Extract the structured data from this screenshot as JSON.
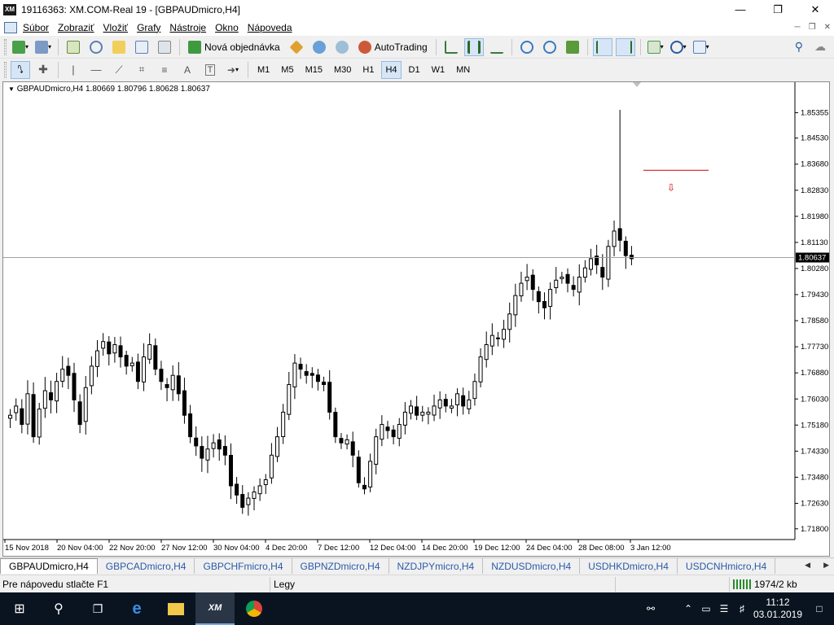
{
  "window": {
    "title": "19116363: XM.COM-Real 19 - [GBPAUDmicro,H4]",
    "logo": "XM"
  },
  "menu": [
    "Súbor",
    "Zobraziť",
    "Vložiť",
    "Grafy",
    "Nástroje",
    "Okno",
    "Nápoveda"
  ],
  "toolbar1": {
    "new_order_label": "Nová objednávka",
    "autotrading_label": "AutoTrading"
  },
  "timeframes": [
    "M1",
    "M5",
    "M15",
    "M30",
    "H1",
    "H4",
    "D1",
    "W1",
    "MN"
  ],
  "active_timeframe": "H4",
  "chart_header": "GBPAUDmicro,H4  1.80669 1.80796 1.80628 1.80637",
  "chart_data": {
    "type": "candlestick",
    "symbol": "GBPAUDmicro",
    "timeframe": "H4",
    "ohlc_header": {
      "open": 1.80669,
      "high": 1.80796,
      "low": 1.80628,
      "close": 1.80637
    },
    "current_price": 1.80637,
    "current_price_label": "1.80637",
    "ylim": [
      1.7145,
      1.8635
    ],
    "y_ticks": [
      1.85355,
      1.8453,
      1.8368,
      1.8283,
      1.8198,
      1.8113,
      1.8028,
      1.7943,
      1.7858,
      1.7773,
      1.7688,
      1.7603,
      1.7518,
      1.7433,
      1.7348,
      1.7263,
      1.718
    ],
    "y_tick_labels": [
      "1.85355",
      "1.84530",
      "1.83680",
      "1.82830",
      "1.81980",
      "1.81130",
      "1.80280",
      "1.79430",
      "1.78580",
      "1.77730",
      "1.76880",
      "1.76030",
      "1.75180",
      "1.74330",
      "1.73480",
      "1.72630",
      "1.71800"
    ],
    "x_tick_labels": [
      "15 Nov 2018",
      "20 Nov 04:00",
      "22 Nov 20:00",
      "27 Nov 12:00",
      "30 Nov 04:00",
      "4 Dec 20:00",
      "7 Dec 12:00",
      "12 Dec 04:00",
      "14 Dec 20:00",
      "19 Dec 12:00",
      "24 Dec 04:00",
      "28 Dec 08:00",
      "3 Jan 12:00"
    ],
    "close_path": [
      1.755,
      1.758,
      1.752,
      1.762,
      1.748,
      1.757,
      1.763,
      1.76,
      1.766,
      1.77,
      1.768,
      1.76,
      1.752,
      1.764,
      1.771,
      1.776,
      1.779,
      1.775,
      1.778,
      1.774,
      1.771,
      1.772,
      1.766,
      1.774,
      1.778,
      1.77,
      1.766,
      1.764,
      1.768,
      1.762,
      1.755,
      1.748,
      1.745,
      1.741,
      1.744,
      1.746,
      1.744,
      1.742,
      1.732,
      1.729,
      1.725,
      1.728,
      1.73,
      1.732,
      1.734,
      1.742,
      1.748,
      1.756,
      1.765,
      1.772,
      1.77,
      1.768,
      1.768,
      1.766,
      1.765,
      1.756,
      1.748,
      1.746,
      1.747,
      1.742,
      1.733,
      1.731,
      1.74,
      1.748,
      1.752,
      1.75,
      1.748,
      1.752,
      1.756,
      1.758,
      1.755,
      1.756,
      1.756,
      1.758,
      1.76,
      1.758,
      1.758,
      1.762,
      1.758,
      1.76,
      1.766,
      1.774,
      1.778,
      1.781,
      1.78,
      1.783,
      1.788,
      1.794,
      1.798,
      1.8,
      1.796,
      1.792,
      1.79,
      1.796,
      1.799,
      1.8,
      1.798,
      1.796,
      1.8,
      1.803,
      1.806,
      1.804,
      1.8,
      1.81,
      1.815,
      1.812,
      1.807,
      1.806
    ],
    "spike": {
      "high": 1.8545,
      "index": 105
    },
    "drawn_level": 1.8348
  },
  "tabs": [
    "GBPAUDmicro,H4",
    "GBPCADmicro,H4",
    "GBPCHFmicro,H4",
    "GBPNZDmicro,H4",
    "NZDJPYmicro,H4",
    "NZDUSDmicro,H4",
    "USDHKDmicro,H4",
    "USDCNHmicro,H4"
  ],
  "status": {
    "help": "Pre nápovedu stlačte F1",
    "profile": "Legy",
    "traffic": "1974/2 kb"
  },
  "taskbar": {
    "time": "11:12",
    "date": "03.01.2019"
  }
}
